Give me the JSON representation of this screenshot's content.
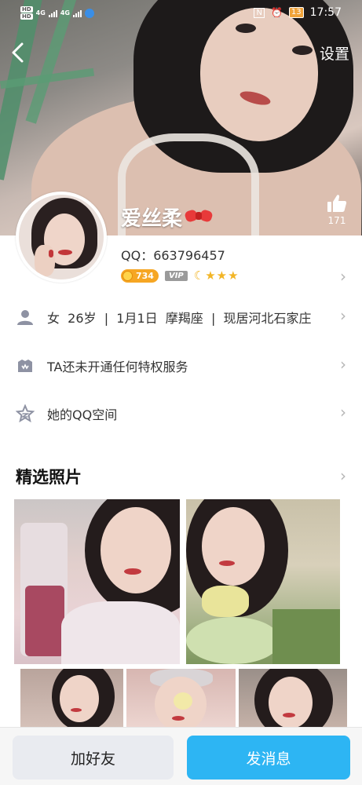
{
  "status_bar": {
    "hd1": "HD",
    "hd2": "HD",
    "net1": "4G",
    "net2": "4G",
    "nfc": "N",
    "battery": "13",
    "time": "17:57"
  },
  "header": {
    "back_icon": "chevron-left-icon",
    "settings_label": "设置"
  },
  "profile": {
    "nickname": "爱丝柔",
    "nickname_emoji": "ribbon-bow-icon",
    "like_count": "171",
    "qq_label": "QQ：663796457",
    "coin_value": "734",
    "vip_label": "VIP",
    "level_icons": [
      "moon",
      "star",
      "star",
      "star"
    ]
  },
  "info_rows": {
    "basic": "女  26岁  |  1月1日  摩羯座  |  现居河北石家庄",
    "privilege": "TA还未开通任何特权服务",
    "qzone": "她的QQ空间"
  },
  "photos": {
    "section_title": "精选照片"
  },
  "actions": {
    "add_friend": "加好友",
    "send_message": "发消息"
  },
  "colors": {
    "primary_button": "#2db5f3",
    "secondary_button": "#e9ebf0",
    "coin": "#f6a623",
    "star": "#f2b526"
  }
}
